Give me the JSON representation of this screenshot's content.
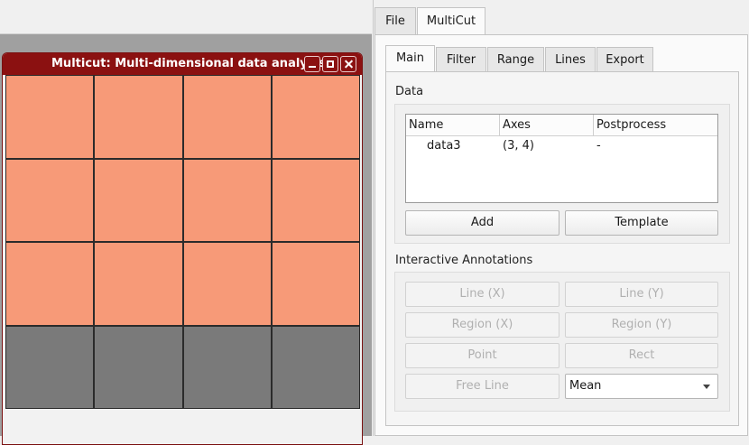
{
  "window": {
    "title": "Multicut: Multi-dimensional data analysis"
  },
  "plot": {
    "colors": {
      "active": "#f79a78",
      "inactive": "#7a7a7a",
      "grid": "#2b2b2b"
    }
  },
  "top_tabs": [
    {
      "label": "File",
      "active": false
    },
    {
      "label": "MultiCut",
      "active": true
    }
  ],
  "inner_tabs": [
    {
      "label": "Main",
      "active": true
    },
    {
      "label": "Filter",
      "active": false
    },
    {
      "label": "Range",
      "active": false
    },
    {
      "label": "Lines",
      "active": false
    },
    {
      "label": "Export",
      "active": false
    }
  ],
  "data_group": {
    "label": "Data",
    "columns": [
      "Name",
      "Axes",
      "Postprocess"
    ],
    "rows": [
      {
        "name": "data3",
        "axes": "(3, 4)",
        "postprocess": "-"
      }
    ],
    "add_label": "Add",
    "template_label": "Template"
  },
  "annotations": {
    "label": "Interactive Annotations",
    "line_x": "Line (X)",
    "line_y": "Line (Y)",
    "region_x": "Region (X)",
    "region_y": "Region (Y)",
    "point": "Point",
    "rect": "Rect",
    "free_line": "Free Line",
    "mode_value": "Mean"
  }
}
